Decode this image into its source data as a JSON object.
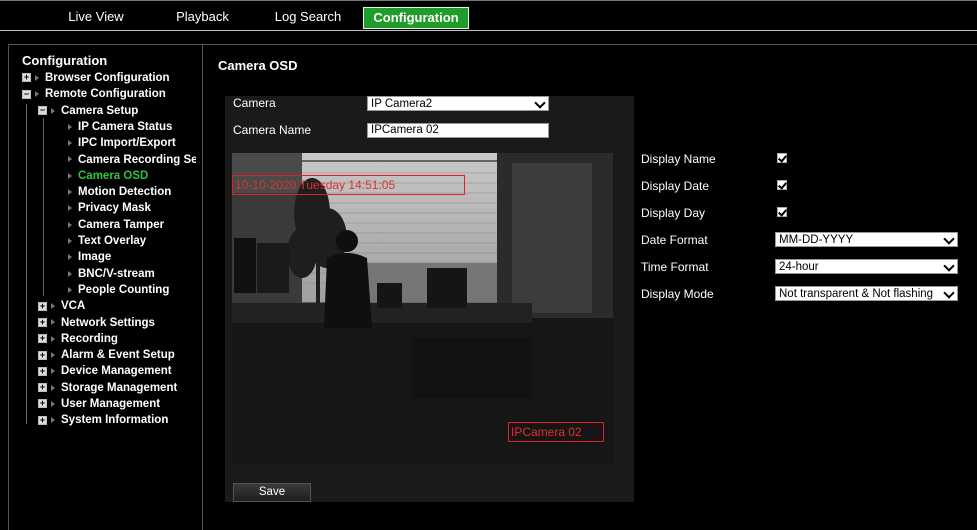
{
  "nav": {
    "tabs": [
      {
        "label": "Live View"
      },
      {
        "label": "Playback"
      },
      {
        "label": "Log Search"
      },
      {
        "label": "Configuration",
        "active": true
      }
    ]
  },
  "tree": {
    "title": "Configuration",
    "items": [
      {
        "label": "Browser Configuration",
        "level": 0,
        "expander": "+"
      },
      {
        "label": "Remote Configuration",
        "level": 0,
        "expander": "-"
      },
      {
        "label": "Camera Setup",
        "level": 1,
        "expander": "-"
      },
      {
        "label": "IP Camera Status",
        "level": 2
      },
      {
        "label": "IPC Import/Export",
        "level": 2
      },
      {
        "label": "Camera Recording Se",
        "level": 2
      },
      {
        "label": "Camera OSD",
        "level": 2,
        "selected": true
      },
      {
        "label": "Motion Detection",
        "level": 2
      },
      {
        "label": "Privacy Mask",
        "level": 2
      },
      {
        "label": "Camera Tamper",
        "level": 2
      },
      {
        "label": "Text Overlay",
        "level": 2
      },
      {
        "label": "Image",
        "level": 2
      },
      {
        "label": "BNC/V-stream",
        "level": 2
      },
      {
        "label": "People Counting",
        "level": 2
      },
      {
        "label": "VCA",
        "level": 1,
        "expander": "+"
      },
      {
        "label": "Network Settings",
        "level": 1,
        "expander": "+"
      },
      {
        "label": "Recording",
        "level": 1,
        "expander": "+"
      },
      {
        "label": "Alarm & Event Setup",
        "level": 1,
        "expander": "+"
      },
      {
        "label": "Device Management",
        "level": 1,
        "expander": "+"
      },
      {
        "label": "Storage Management",
        "level": 1,
        "expander": "+"
      },
      {
        "label": "User Management",
        "level": 1,
        "expander": "+"
      },
      {
        "label": "System Information",
        "level": 1,
        "expander": "+"
      }
    ]
  },
  "main": {
    "title": "Camera OSD",
    "camera_label": "Camera",
    "camera_value": "IP Camera2",
    "camera_name_label": "Camera Name",
    "camera_name_value": "IPCamera 02",
    "preview": {
      "osd_datetime": "10-10-2020 Tuesday 14:51:05",
      "osd_name": "IPCamera 02"
    },
    "save_label": "Save"
  },
  "settings": {
    "display_name_label": "Display Name",
    "display_name_checked": true,
    "display_date_label": "Display Date",
    "display_date_checked": true,
    "display_day_label": "Display Day",
    "display_day_checked": true,
    "date_format_label": "Date Format",
    "date_format_value": "MM-DD-YYYY",
    "time_format_label": "Time Format",
    "time_format_value": "24-hour",
    "display_mode_label": "Display Mode",
    "display_mode_value": "Not transparent & Not flashing"
  },
  "colors": {
    "accent_green": "#1f9c2a",
    "selected_text": "#2ec43a",
    "osd_red": "#dd2222"
  }
}
